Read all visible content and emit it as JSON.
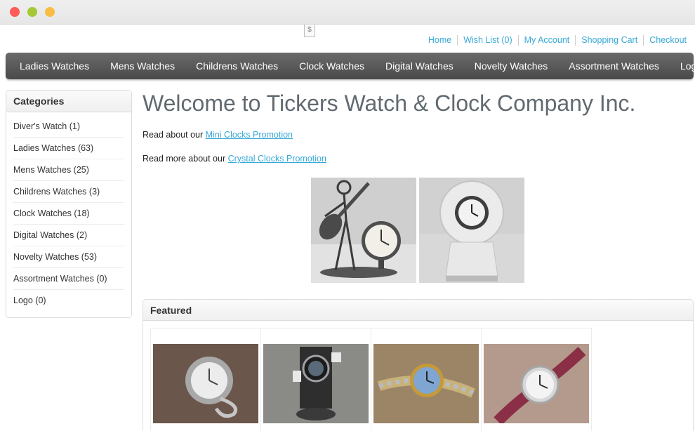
{
  "currency_symbol": "$",
  "top_links": [
    "Home",
    "Wish List (0)",
    "My Account",
    "Shopping Cart",
    "Checkout"
  ],
  "menu": [
    "Ladies Watches",
    "Mens Watches",
    "Childrens Watches",
    "Clock Watches",
    "Digital Watches",
    "Novelty Watches",
    "Assortment Watches",
    "Logo"
  ],
  "sidebar": {
    "heading": "Categories",
    "items": [
      "Diver's Watch (1)",
      "Ladies Watches (63)",
      "Mens Watches (25)",
      "Childrens Watches (3)",
      "Clock Watches (18)",
      "Digital Watches (2)",
      "Novelty Watches (53)",
      "Assortment Watches (0)",
      "Logo (0)"
    ]
  },
  "main": {
    "title": "Welcome to Tickers Watch & Clock Company Inc.",
    "promo1_prefix": "Read about our ",
    "promo1_link": "Mini Clocks Promotion",
    "promo2_prefix": "Read more about our ",
    "promo2_link": "Crystal Clocks Promotion",
    "featured_heading": "Featured"
  },
  "colors": {
    "link": "#38a9d6",
    "menu_bg": "#555555",
    "title": "#616a70"
  }
}
